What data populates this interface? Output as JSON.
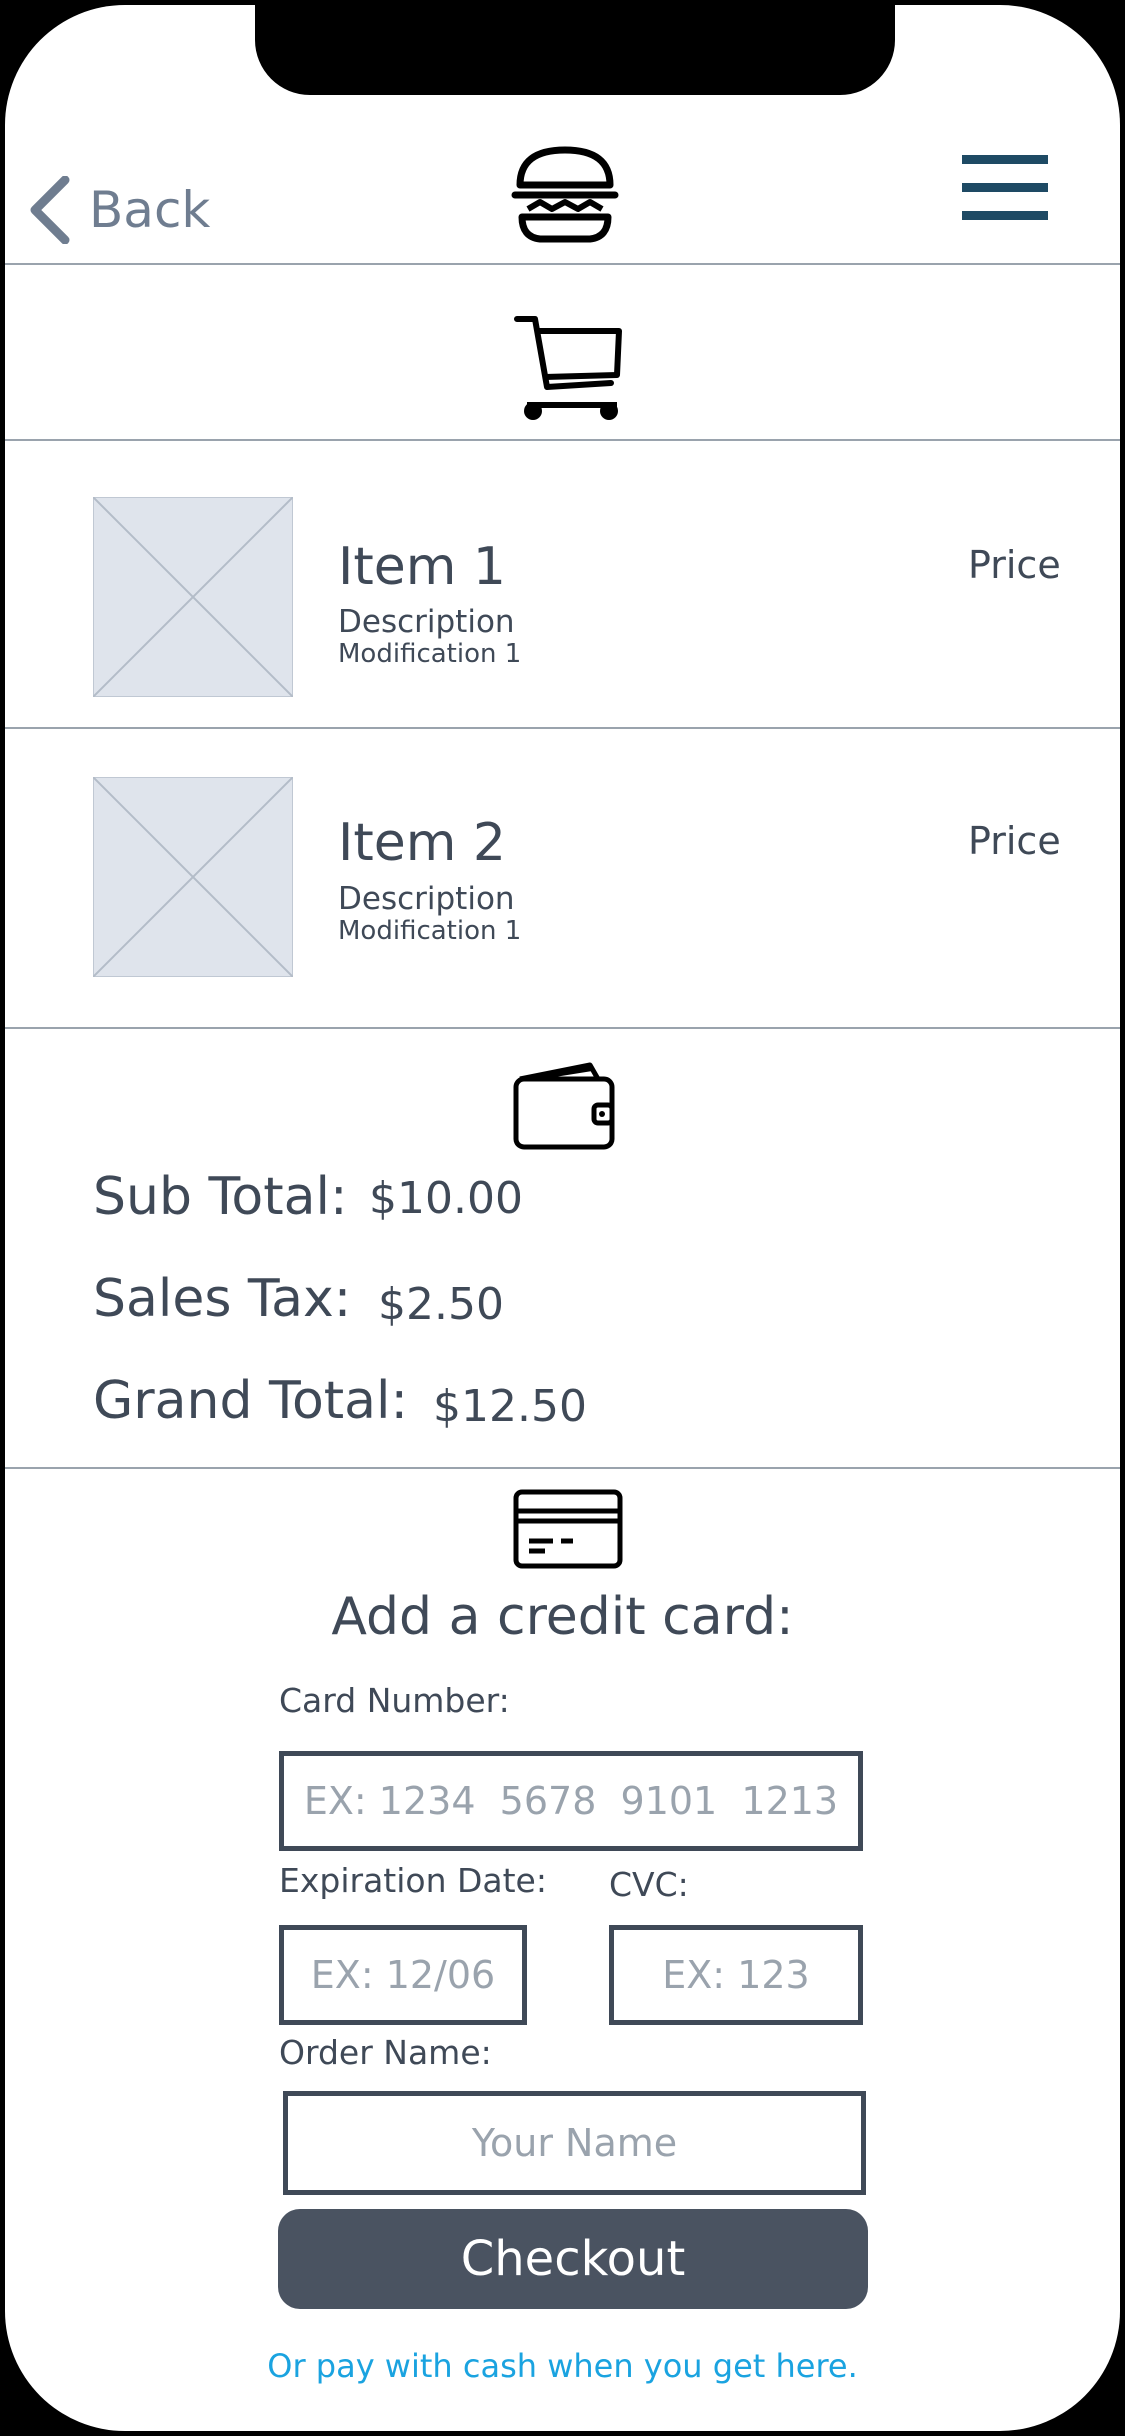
{
  "header": {
    "back_label": "Back",
    "logo_icon": "burger-icon",
    "menu_icon": "hamburger-menu-icon"
  },
  "cart": {
    "icon": "shopping-cart-icon"
  },
  "items": [
    {
      "name": "Item 1",
      "description": "Description",
      "modification": "Modification 1",
      "price": "Price"
    },
    {
      "name": "Item 2",
      "description": "Description",
      "modification": "Modification 1",
      "price": "Price"
    }
  ],
  "totals": {
    "icon": "wallet-icon",
    "subtotal_label": "Sub Total:",
    "subtotal_value": "$10.00",
    "tax_label": "Sales Tax:",
    "tax_value": "$2.50",
    "grand_label": "Grand Total:",
    "grand_value": "$12.50"
  },
  "payment": {
    "icon": "credit-card-icon",
    "title": "Add a credit card:",
    "card_number_label": "Card Number:",
    "card_number_placeholder": "EX: 1234  5678  9101  1213",
    "expiration_label": "Expiration Date:",
    "expiration_placeholder": "EX: 12/06",
    "cvc_label": "CVC:",
    "cvc_placeholder": "EX: 123",
    "order_name_label": "Order Name:",
    "order_name_placeholder": "Your Name",
    "checkout_label": "Checkout",
    "cash_link": "Or pay with cash when you get here."
  },
  "colors": {
    "text": "#3f4957",
    "muted": "#6f7d90",
    "menu": "#1e4a64",
    "button": "#4a5361",
    "link": "#1aa3e0",
    "placeholder_image": "#dfe4ec"
  }
}
